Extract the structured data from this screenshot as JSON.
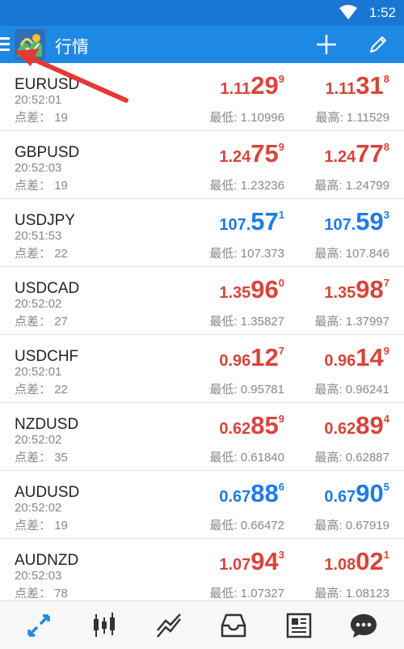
{
  "status_bar": {
    "time": "1:52"
  },
  "app_bar": {
    "title": "行情"
  },
  "colors": {
    "status_bar": "#1976d2",
    "app_bar": "#1e88e5",
    "price_up": "#d9443a",
    "price_down": "#1e7be8",
    "active_nav": "#1e88e5",
    "annotation_arrow": "#e53935"
  },
  "quotes": [
    {
      "symbol": "EURUSD",
      "time": "20:52:01",
      "spread_label": "点差：",
      "spread": "19",
      "bid": {
        "head": "1.11",
        "big": "29",
        "sup": "9"
      },
      "ask": {
        "head": "1.11",
        "big": "31",
        "sup": "8"
      },
      "low_label": "最低:",
      "low": "1.10996",
      "high_label": "最高:",
      "high": "1.11529",
      "color": "red"
    },
    {
      "symbol": "GBPUSD",
      "time": "20:52:03",
      "spread_label": "点差：",
      "spread": "19",
      "bid": {
        "head": "1.24",
        "big": "75",
        "sup": "9"
      },
      "ask": {
        "head": "1.24",
        "big": "77",
        "sup": "8"
      },
      "low_label": "最低:",
      "low": "1.23236",
      "high_label": "最高:",
      "high": "1.24799",
      "color": "red"
    },
    {
      "symbol": "USDJPY",
      "time": "20:51:53",
      "spread_label": "点差：",
      "spread": "22",
      "bid": {
        "head": "107.",
        "big": "57",
        "sup": "1"
      },
      "ask": {
        "head": "107.",
        "big": "59",
        "sup": "3"
      },
      "low_label": "最低:",
      "low": "107.373",
      "high_label": "最高:",
      "high": "107.846",
      "color": "blue"
    },
    {
      "symbol": "USDCAD",
      "time": "20:52:02",
      "spread_label": "点差：",
      "spread": "27",
      "bid": {
        "head": "1.35",
        "big": "96",
        "sup": "0"
      },
      "ask": {
        "head": "1.35",
        "big": "98",
        "sup": "7"
      },
      "low_label": "最低:",
      "low": "1.35827",
      "high_label": "最高:",
      "high": "1.37997",
      "color": "red"
    },
    {
      "symbol": "USDCHF",
      "time": "20:52:01",
      "spread_label": "点差：",
      "spread": "22",
      "bid": {
        "head": "0.96",
        "big": "12",
        "sup": "7"
      },
      "ask": {
        "head": "0.96",
        "big": "14",
        "sup": "9"
      },
      "low_label": "最低:",
      "low": "0.95781",
      "high_label": "最高:",
      "high": "0.96241",
      "color": "red"
    },
    {
      "symbol": "NZDUSD",
      "time": "20:52:02",
      "spread_label": "点差：",
      "spread": "35",
      "bid": {
        "head": "0.62",
        "big": "85",
        "sup": "9"
      },
      "ask": {
        "head": "0.62",
        "big": "89",
        "sup": "4"
      },
      "low_label": "最低:",
      "low": "0.61840",
      "high_label": "最高:",
      "high": "0.62887",
      "color": "red"
    },
    {
      "symbol": "AUDUSD",
      "time": "20:52:02",
      "spread_label": "点差：",
      "spread": "19",
      "bid": {
        "head": "0.67",
        "big": "88",
        "sup": "6"
      },
      "ask": {
        "head": "0.67",
        "big": "90",
        "sup": "5"
      },
      "low_label": "最低:",
      "low": "0.66472",
      "high_label": "最高:",
      "high": "0.67919",
      "color": "blue"
    },
    {
      "symbol": "AUDNZD",
      "time": "20:52:03",
      "spread_label": "点差：",
      "spread": "78",
      "bid": {
        "head": "1.07",
        "big": "94",
        "sup": "3"
      },
      "ask": {
        "head": "1.08",
        "big": "02",
        "sup": "1"
      },
      "low_label": "最低:",
      "low": "1.07327",
      "high_label": "最高:",
      "high": "1.08123",
      "color": "red"
    }
  ],
  "bottom_nav": [
    {
      "icon": "quotes-arrows-icon",
      "active": true
    },
    {
      "icon": "candlestick-chart-icon",
      "active": false
    },
    {
      "icon": "trade-trend-icon",
      "active": false
    },
    {
      "icon": "inbox-tray-icon",
      "active": false
    },
    {
      "icon": "news-icon",
      "active": false
    },
    {
      "icon": "chat-bubble-icon",
      "active": false
    }
  ]
}
